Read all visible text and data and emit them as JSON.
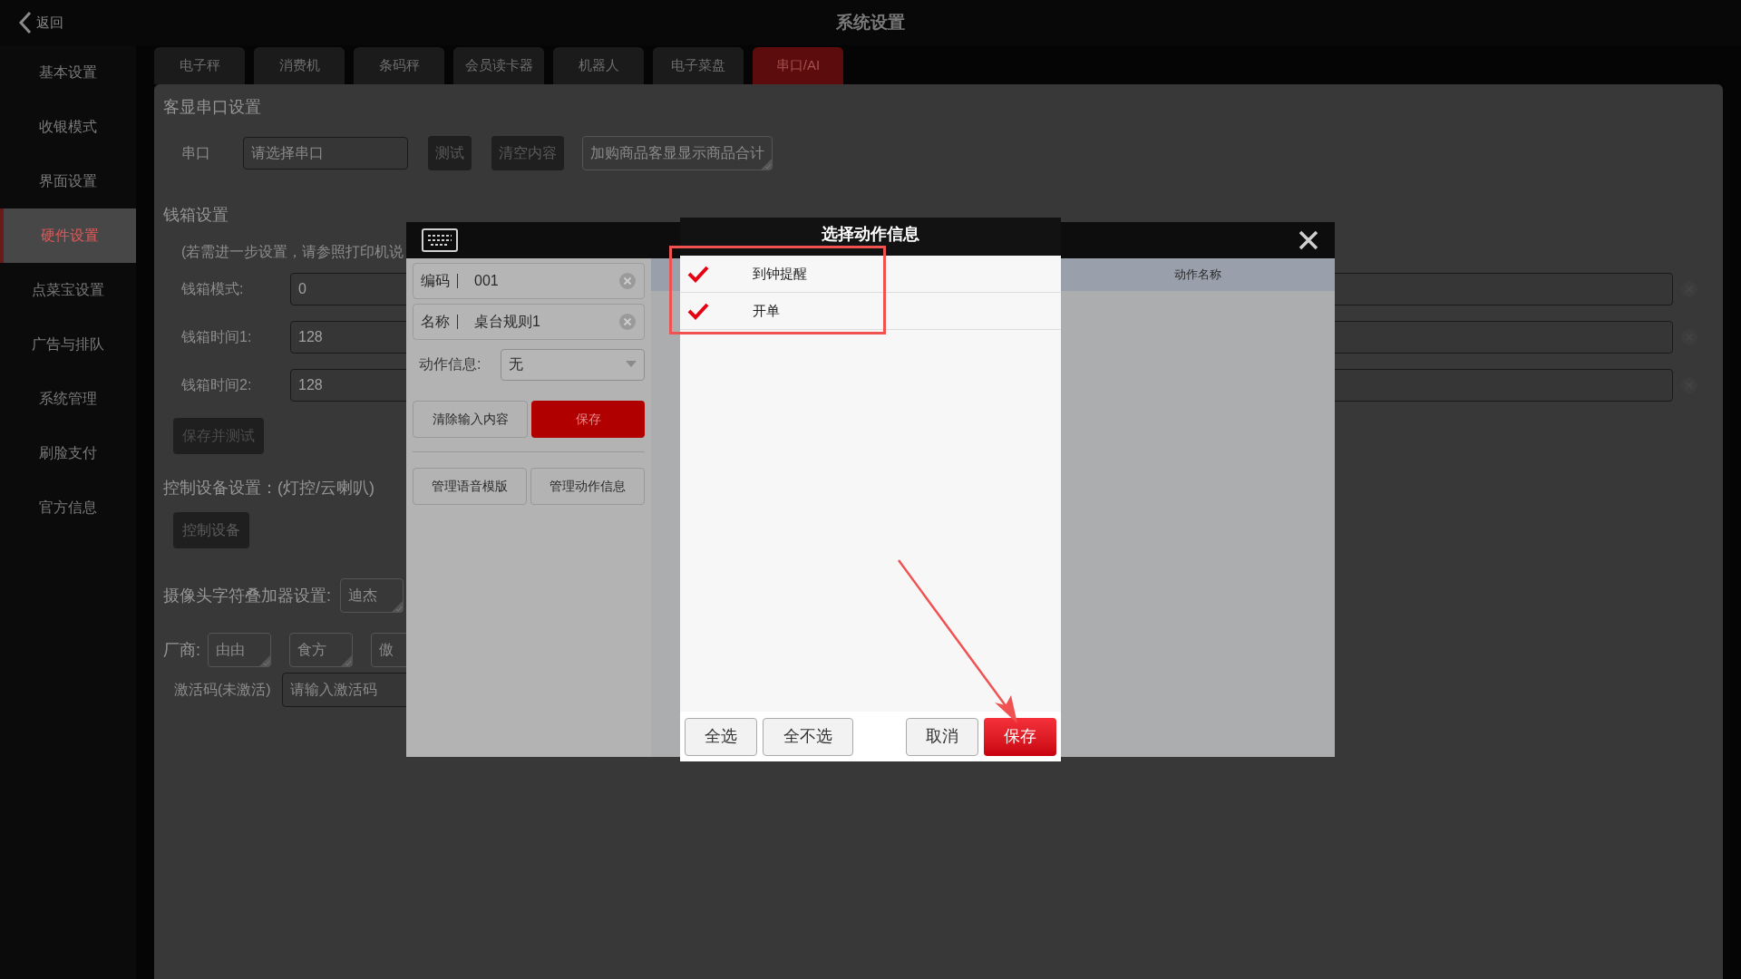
{
  "header": {
    "back": "返回",
    "title": "系统设置"
  },
  "sidebar": {
    "items": [
      {
        "label": "基本设置",
        "selected": false
      },
      {
        "label": "收银模式",
        "selected": false
      },
      {
        "label": "界面设置",
        "selected": false
      },
      {
        "label": "硬件设置",
        "selected": true
      },
      {
        "label": "点菜宝设置",
        "selected": false
      },
      {
        "label": "广告与排队",
        "selected": false
      },
      {
        "label": "系统管理",
        "selected": false
      },
      {
        "label": "刷脸支付",
        "selected": false
      },
      {
        "label": "官方信息",
        "selected": false
      }
    ]
  },
  "tabs": [
    {
      "label": "电子秤",
      "selected": false
    },
    {
      "label": "消费机",
      "selected": false
    },
    {
      "label": "条码秤",
      "selected": false
    },
    {
      "label": "会员读卡器",
      "selected": false
    },
    {
      "label": "机器人",
      "selected": false
    },
    {
      "label": "电子菜盘",
      "selected": false
    },
    {
      "label": "串口/AI",
      "selected": true
    }
  ],
  "display_serial": {
    "heading": "客显串口设置",
    "label": "串口",
    "placeholder": "请选择串口",
    "buttons": [
      "测试",
      "清空内容"
    ],
    "option": "加购商品客显显示商品合计"
  },
  "cash_drawer": {
    "heading": "钱箱设置",
    "note": "(若需进一步设置，请参照打印机说",
    "fields": [
      {
        "label": "钱箱模式:",
        "value": "0"
      },
      {
        "label": "钱箱时间1:",
        "value": "128"
      },
      {
        "label": "钱箱时间2:",
        "value": "128"
      }
    ],
    "button": "保存并测试"
  },
  "control": {
    "heading": "控制设备设置：(灯控/云喇叭)",
    "button": "控制设备"
  },
  "camera": {
    "label": "摄像头字符叠加器设置:",
    "value": "迪杰"
  },
  "vendor": {
    "label": "厂商:",
    "options": [
      "由由",
      "食方",
      "傲"
    ]
  },
  "activation": {
    "label": "激活码(未激活)",
    "placeholder": "请输入激活码"
  },
  "rule_dialog": {
    "fields": [
      {
        "label": "编码",
        "value": "001"
      },
      {
        "label": "名称",
        "value": "桌台规则1"
      }
    ],
    "action": {
      "label": "动作信息:",
      "value": "无"
    },
    "buttons": [
      {
        "label": "清除输入内容",
        "kind": "plain"
      },
      {
        "label": "保存",
        "kind": "primary"
      }
    ],
    "manage_buttons": [
      "管理语音模版",
      "管理动作信息"
    ],
    "table": {
      "columns": [
        "动作名称"
      ]
    }
  },
  "action_dialog": {
    "title": "选择动作信息",
    "items": [
      {
        "label": "到钟提醒",
        "checked": true
      },
      {
        "label": "开单",
        "checked": true
      }
    ],
    "buttons": [
      {
        "label": "全选",
        "kind": "plain"
      },
      {
        "label": "全不选",
        "kind": "plain"
      },
      {
        "label": "取消",
        "kind": "plain"
      },
      {
        "label": "保存",
        "kind": "primary"
      }
    ]
  }
}
